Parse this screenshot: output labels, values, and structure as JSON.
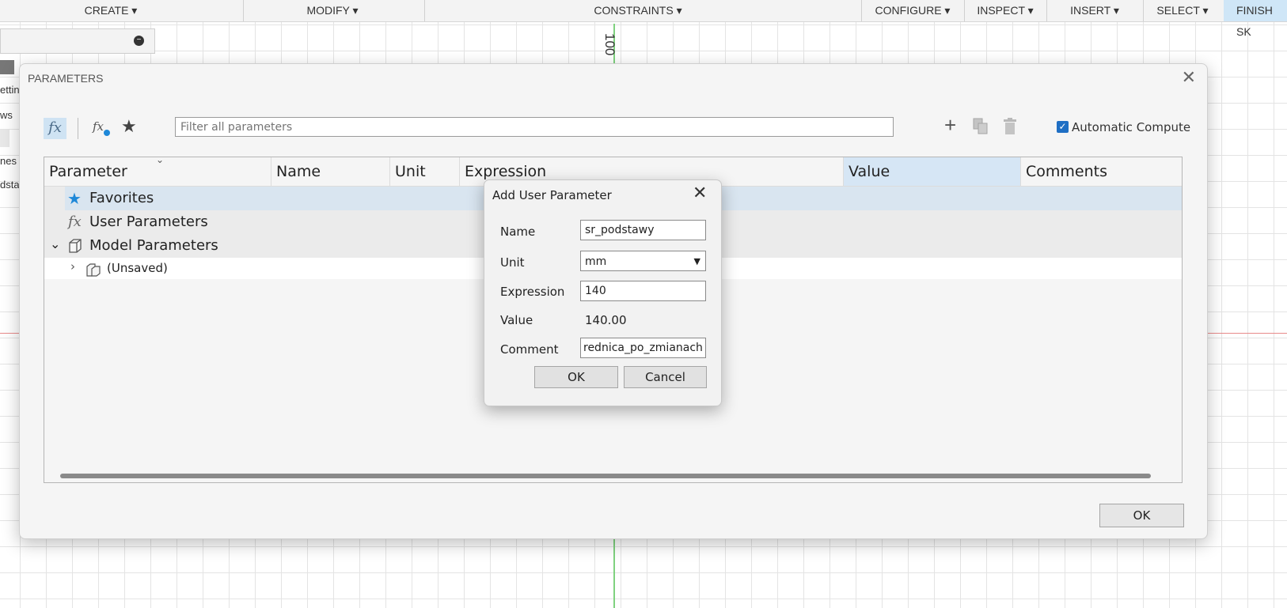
{
  "toolbar": {
    "items": [
      "CREATE ▾",
      "MODIFY ▾",
      "CONSTRAINTS ▾",
      "CONFIGURE ▾",
      "INSPECT ▾",
      "INSERT ▾",
      "SELECT ▾",
      "FINISH SK"
    ]
  },
  "canvas": {
    "dimension_text": "100",
    "sidebar_fragments": [
      "ettin",
      "ws",
      "nes",
      "dsta"
    ]
  },
  "params_dialog": {
    "title": "PARAMETERS",
    "filter_placeholder": "Filter all parameters",
    "automatic_compute_label": "Automatic Compute",
    "automatic_compute_checked": true,
    "columns": [
      "Parameter",
      "Name",
      "Unit",
      "Expression",
      "Value",
      "Comments"
    ],
    "tree": {
      "favorites": "Favorites",
      "user_parameters": "User Parameters",
      "model_parameters": "Model Parameters",
      "unsaved": "(Unsaved)"
    },
    "ok_label": "OK",
    "icons": [
      "fx-icon",
      "user-fx-icon",
      "star-icon",
      "plus-icon",
      "copy-icon",
      "trash-icon",
      "close-icon"
    ]
  },
  "add_user_parameter": {
    "title": "Add User Parameter",
    "name_label": "Name",
    "name_value": "sr_podstawy",
    "unit_label": "Unit",
    "unit_value": "mm",
    "expression_label": "Expression",
    "expression_value": "140",
    "value_label": "Value",
    "value_text": "140.00",
    "comment_label": "Comment",
    "comment_value": "rednica_po_zmianach",
    "ok_label": "OK",
    "cancel_label": "Cancel"
  },
  "colors": {
    "accent": "#1f6fc4",
    "selection": "#d6e6f5",
    "star": "#1e88d8"
  }
}
